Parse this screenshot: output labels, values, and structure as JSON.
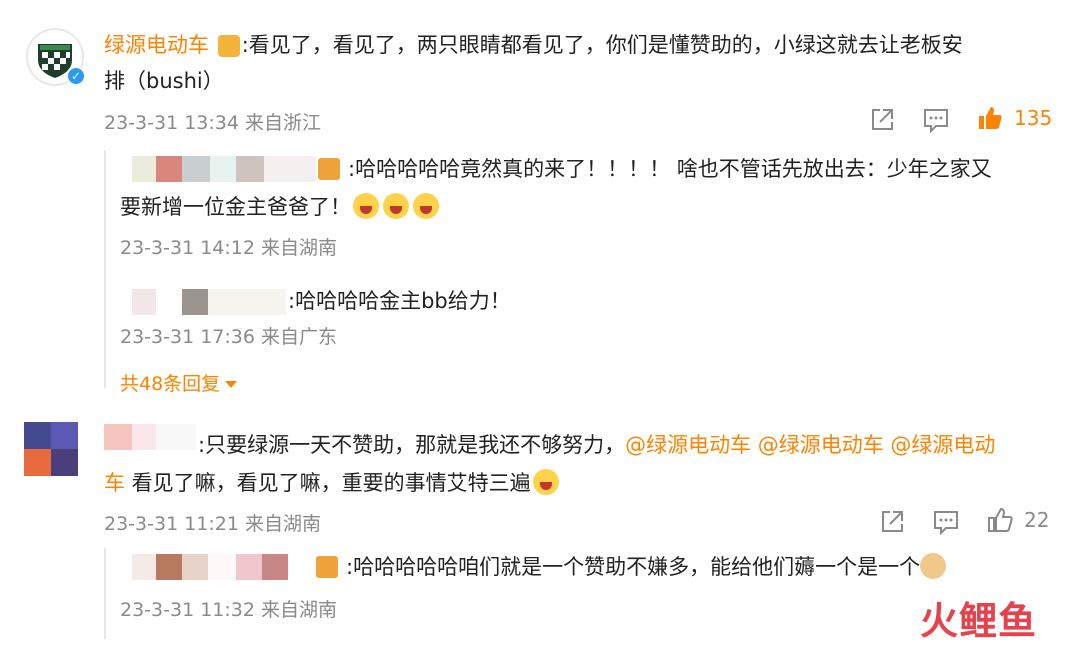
{
  "comment1": {
    "username": "绿源电动车",
    "text_line1": ":看见了，看见了，两只眼睛都看见了，你们是懂赞助的，小绿这就去让老板安",
    "text_line2": "排（bushi）",
    "meta": "23-3-31 13:34 来自浙江",
    "like_count": "135",
    "replies": [
      {
        "text_line1": ":哈哈哈哈哈竟然真的来了！！！！ 啥也不管话先放出去：少年之家又",
        "text_line2": "要新增一位金主爸爸了！",
        "meta": "23-3-31 14:12 来自湖南"
      },
      {
        "text_line1": ":哈哈哈哈金主bb给力！",
        "meta": "23-3-31 17:36 来自广东"
      }
    ],
    "more_replies": "共48条回复"
  },
  "comment2": {
    "text_line1_prefix": ":只要绿源一天不赞助，那就是我还不够努力，",
    "mentions_line1": "@绿源电动车 @绿源电动车 @绿源电动",
    "mention_line2": "车",
    "text_line2": " 看见了嘛，看见了嘛，重要的事情艾特三遍",
    "meta": "23-3-31 11:21 来自湖南",
    "like_count": "22",
    "replies": [
      {
        "text_line1": ":哈哈哈哈哈咱们就是一个赞助不嫌多，能给他们薅一个是一个",
        "meta": "23-3-31 11:32 来自湖南"
      }
    ]
  },
  "watermark": "火鲤鱼",
  "icons": [
    "share-icon",
    "comment-icon",
    "like-icon",
    "verified-icon",
    "emoji-icon",
    "caret-down-icon"
  ],
  "colors": {
    "accent": "#ff8200",
    "meta": "#8a8a8a",
    "like_active": "#ff8200"
  }
}
